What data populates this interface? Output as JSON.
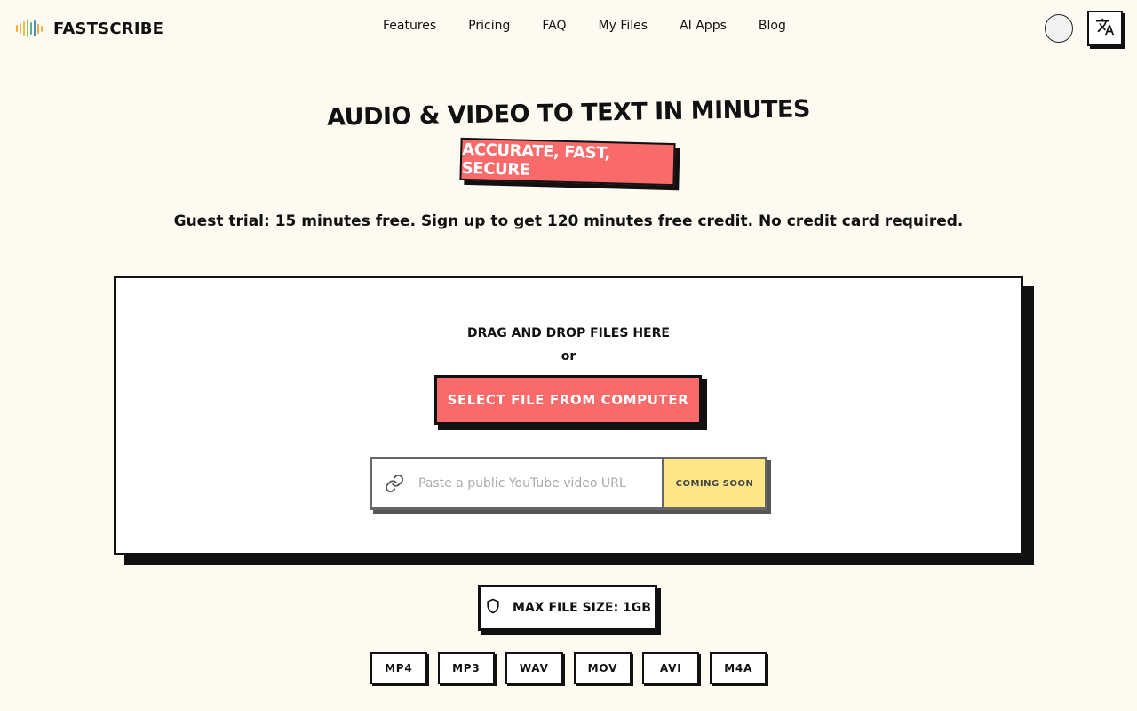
{
  "header": {
    "brand": "FASTSCRIBE",
    "logo_bar_colors": [
      "#f3a93b",
      "#f0b54a",
      "#e2c04c",
      "#9cc35a",
      "#5fae8f",
      "#4a8fb8",
      "#f0a53a",
      "#f4b24a"
    ],
    "nav": [
      "Features",
      "Pricing",
      "FAQ",
      "My Files",
      "AI Apps",
      "Blog"
    ],
    "avatar_icon": "user-avatar",
    "language_icon": "translate-icon"
  },
  "hero": {
    "title": "AUDIO & VIDEO TO TEXT IN MINUTES",
    "badge": "ACCURATE, FAST, SECURE",
    "subtitle": "Guest trial: 15 minutes free. Sign up to get 120 minutes free credit. No credit card required."
  },
  "upload": {
    "drag_text": "DRAG AND DROP FILES HERE",
    "or_text": "or",
    "select_button": "SELECT FILE FROM COMPUTER",
    "url_placeholder": "Paste a public YouTube video URL",
    "url_icon": "link-icon",
    "coming_soon": "COMING SOON"
  },
  "limits": {
    "max_file_size": "MAX FILE SIZE: 1GB",
    "icon": "shield-icon"
  },
  "formats": [
    "MP4",
    "MP3",
    "WAV",
    "MOV",
    "AVI",
    "M4A"
  ],
  "colors": {
    "background": "#fdfaf2",
    "accent": "#f96a6a",
    "coming_soon": "#fde688",
    "border": "#111111"
  }
}
